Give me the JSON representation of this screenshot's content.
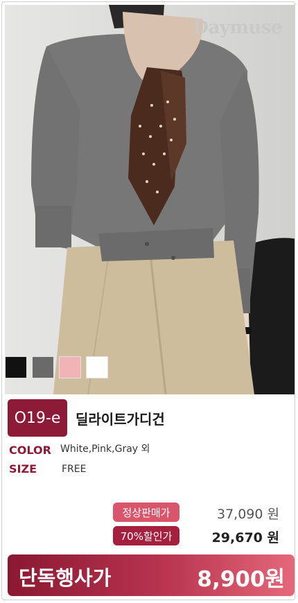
{
  "brand": "Daymuse",
  "swatches": [
    "#111111",
    "#6a6a6a",
    "#f1b3b6",
    "#ffffff"
  ],
  "product": {
    "code": "O19-e",
    "name": "딜라이트가디건"
  },
  "specs": {
    "color_label": "COLOR",
    "color_value": "White,Pink,Gray 외",
    "size_label": "SIZE",
    "size_value": "FREE"
  },
  "pricing": {
    "regular_label": "정상판매가",
    "regular_price": "37,090 원",
    "discount_label": "70%할인가",
    "discount_price": "29,670 원",
    "exclusive_label": "단독행사가",
    "exclusive_price": "8,900원"
  },
  "colors": {
    "accent": "#8d1a36",
    "regular_tag": "#d9556b",
    "discount_tag": "#a5203f"
  }
}
